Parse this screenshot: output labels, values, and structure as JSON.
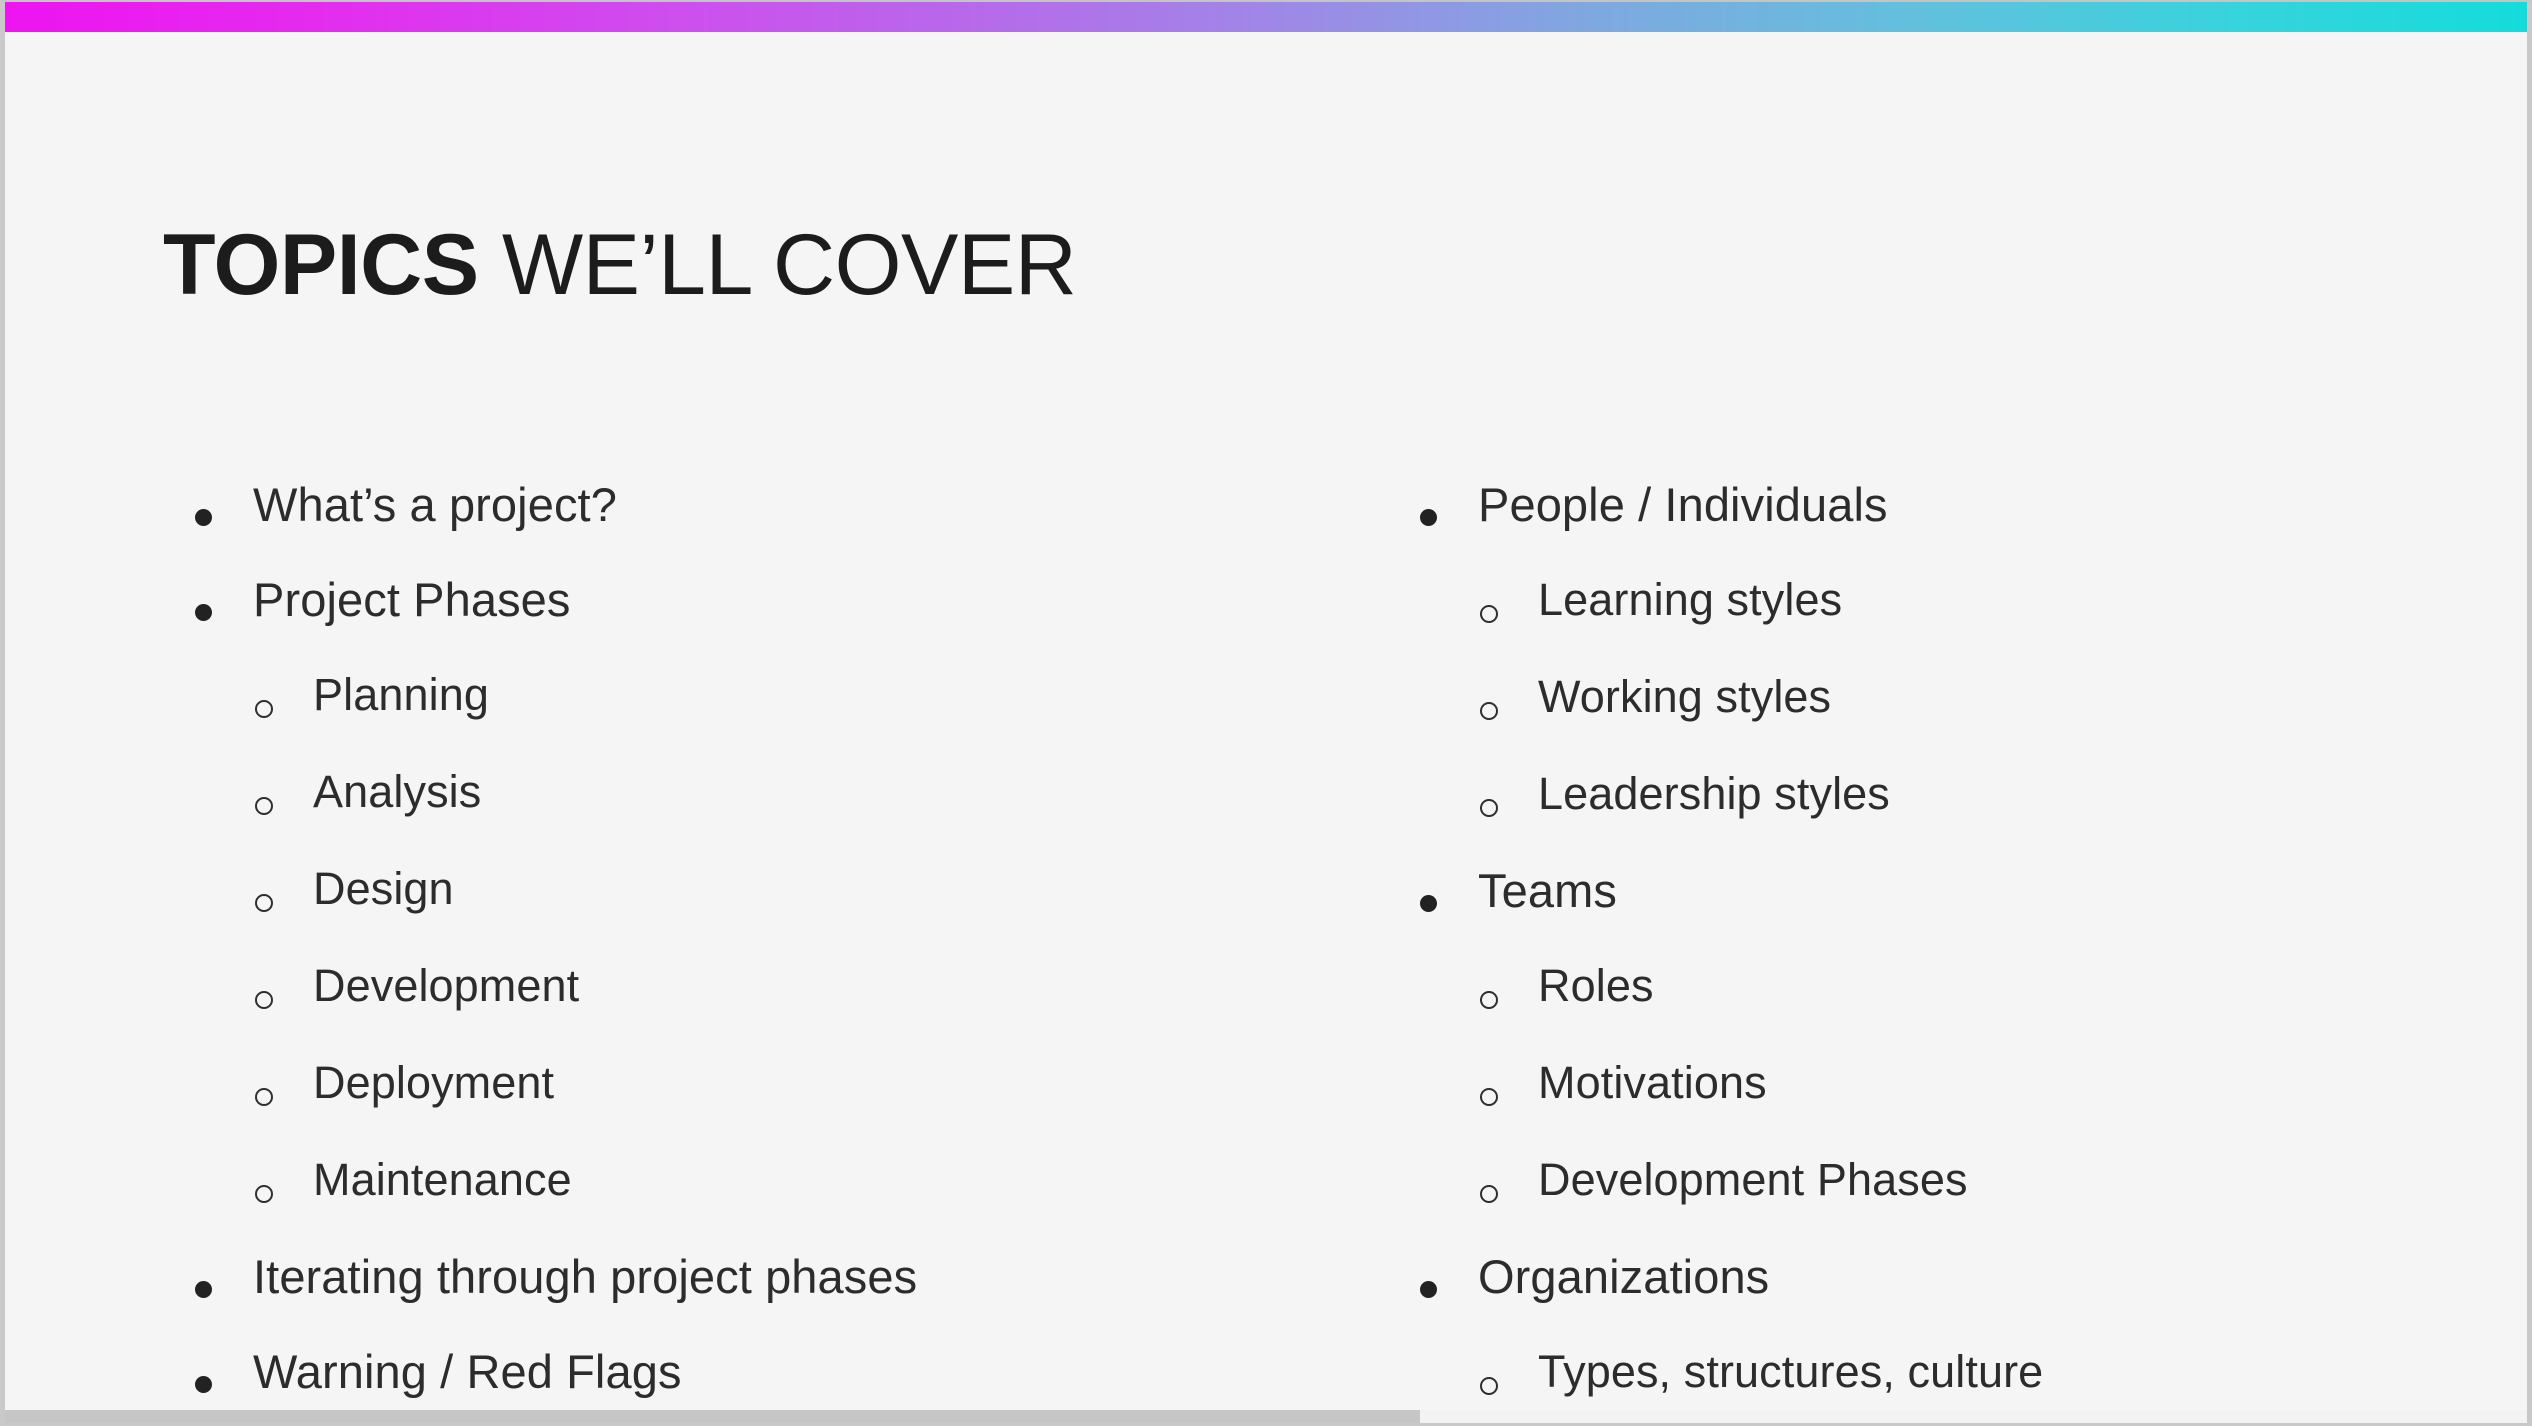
{
  "slide": {
    "title": {
      "strong": "TOPICS",
      "rest": " WE’LL COVER"
    },
    "background_color": "#f5f5f5",
    "text_color": "#2c2c2c"
  },
  "accent_bar": {
    "start_color": "#ee14f0",
    "mid_color": "#9b8ce6",
    "end_color": "#14dcdb"
  },
  "columns": {
    "left": {
      "items": [
        {
          "level": 1,
          "label": "What’s a project?"
        },
        {
          "level": 1,
          "label": "Project Phases"
        },
        {
          "level": 2,
          "label": "Planning"
        },
        {
          "level": 2,
          "label": "Analysis"
        },
        {
          "level": 2,
          "label": "Design"
        },
        {
          "level": 2,
          "label": "Development"
        },
        {
          "level": 2,
          "label": "Deployment"
        },
        {
          "level": 2,
          "label": "Maintenance"
        },
        {
          "level": 1,
          "label": "Iterating through project phases"
        },
        {
          "level": 1,
          "label": "Warning / Red Flags"
        }
      ]
    },
    "right": {
      "items": [
        {
          "level": 1,
          "label": "People / Individuals"
        },
        {
          "level": 2,
          "label": "Learning styles"
        },
        {
          "level": 2,
          "label": "Working styles"
        },
        {
          "level": 2,
          "label": "Leadership styles"
        },
        {
          "level": 1,
          "label": "Teams"
        },
        {
          "level": 2,
          "label": "Roles"
        },
        {
          "level": 2,
          "label": "Motivations"
        },
        {
          "level": 2,
          "label": "Development Phases"
        },
        {
          "level": 1,
          "label": "Organizations"
        },
        {
          "level": 2,
          "label": "Types, structures, culture"
        }
      ]
    }
  },
  "scrollbar": {
    "orientation": "horizontal",
    "thumb_fraction": 0.56
  }
}
